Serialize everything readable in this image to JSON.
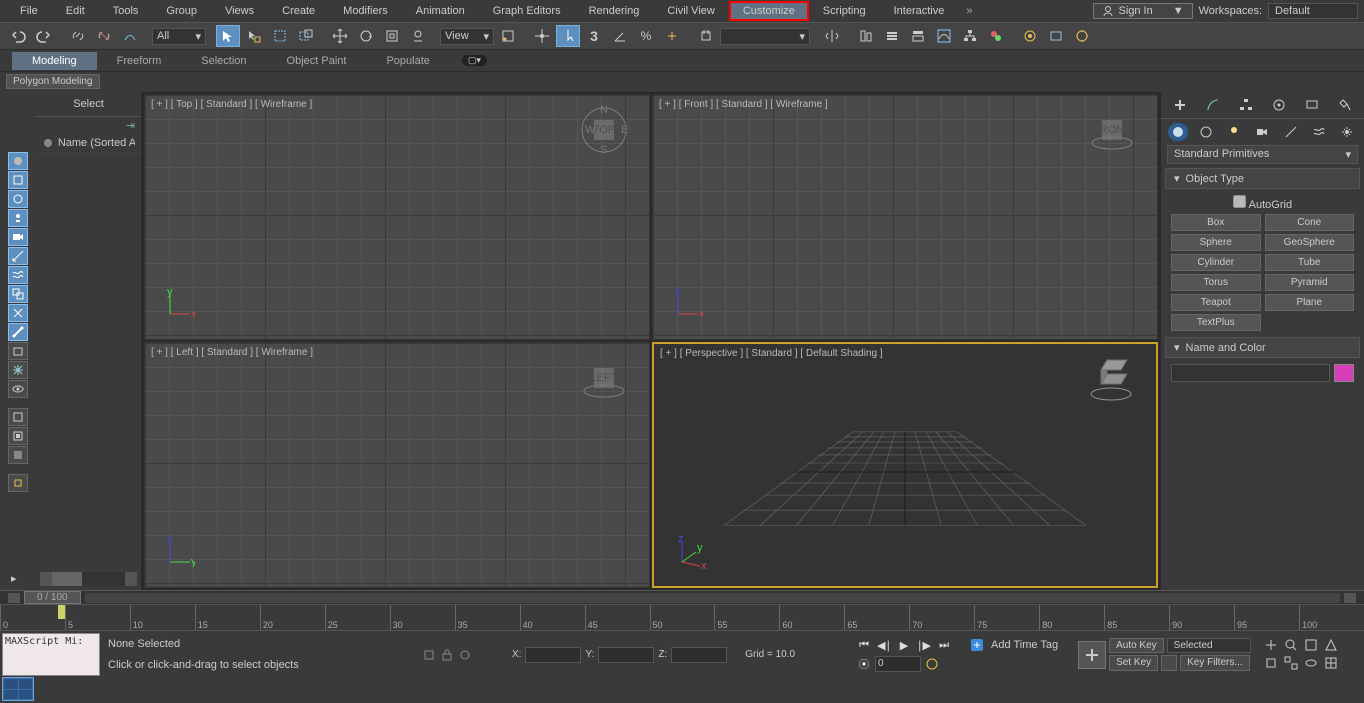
{
  "menu": {
    "items": [
      "File",
      "Edit",
      "Tools",
      "Group",
      "Views",
      "Create",
      "Modifiers",
      "Animation",
      "Graph Editors",
      "Rendering",
      "Civil View",
      "Customize",
      "Scripting",
      "Interactive"
    ],
    "signin": "Sign In",
    "workspaces_label": "Workspaces:",
    "workspaces_value": "Default",
    "highlighted": "Customize"
  },
  "toolbar": {
    "all": "All",
    "view": "View"
  },
  "ribbon": {
    "tabs": [
      "Modeling",
      "Freeform",
      "Selection",
      "Object Paint",
      "Populate"
    ],
    "active": "Modeling",
    "sub": "Polygon Modeling"
  },
  "select": {
    "title": "Select",
    "name_col": "Name (Sorted A"
  },
  "viewports": {
    "top": "[ + ] [ Top ] [ Standard ] [ Wireframe ]",
    "front": "[ + ] [ Front ] [ Standard ] [ Wireframe ]",
    "left": "[ + ] [ Left ] [ Standard ] [ Wireframe ]",
    "persp": "[ + ] [ Perspective ] [ Standard ] [ Default Shading ]"
  },
  "command": {
    "primitives": "Standard Primitives",
    "objtype": "Object Type",
    "autogrid": "AutoGrid",
    "buttons": [
      [
        "Box",
        "Cone"
      ],
      [
        "Sphere",
        "GeoSphere"
      ],
      [
        "Cylinder",
        "Tube"
      ],
      [
        "Torus",
        "Pyramid"
      ],
      [
        "Teapot",
        "Plane"
      ],
      [
        "TextPlus",
        ""
      ]
    ],
    "namecolor": "Name and Color"
  },
  "time": {
    "slider": "0 / 100",
    "ticks": [
      0,
      5,
      10,
      15,
      20,
      25,
      30,
      35,
      40,
      45,
      50,
      55,
      60,
      65,
      70,
      75,
      80,
      85,
      90,
      95,
      100
    ]
  },
  "status": {
    "script": "MAXScript Mi:",
    "sel": "None Selected",
    "hint": "Click or click-and-drag to select objects",
    "x": "X:",
    "y": "Y:",
    "z": "Z:",
    "grid": "Grid = 10.0",
    "addtime": "Add Time Tag",
    "frame": "0",
    "autokey": "Auto Key",
    "setkey": "Set Key",
    "selected": "Selected",
    "keyfilters": "Key Filters..."
  }
}
